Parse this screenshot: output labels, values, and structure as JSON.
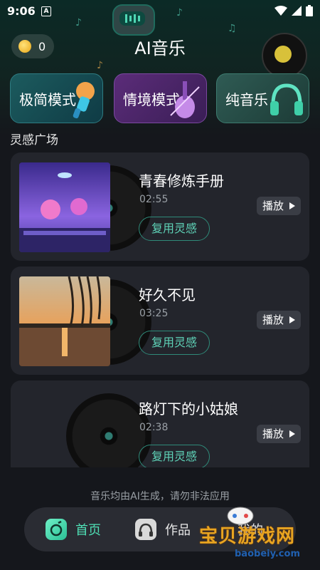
{
  "status": {
    "time": "9:06",
    "a_icon": "A",
    "icons": [
      "wifi-icon",
      "signal-icon",
      "battery-icon"
    ]
  },
  "header": {
    "coins": "0",
    "title": "AI音乐"
  },
  "modes": [
    {
      "label": "极简模式",
      "icon": "microphone-icon"
    },
    {
      "label": "情境模式",
      "icon": "violin-icon"
    },
    {
      "label": "纯音乐",
      "icon": "headphones-icon"
    }
  ],
  "section": {
    "title": "灵感广场"
  },
  "cards": [
    {
      "song": "青春修炼手册",
      "duration": "02:55",
      "reuse_label": "复用灵感",
      "play_label": "播放"
    },
    {
      "song": "好久不见",
      "duration": "03:25",
      "reuse_label": "复用灵感",
      "play_label": "播放"
    },
    {
      "song": "路灯下的小姑娘",
      "duration": "02:38",
      "reuse_label": "复用灵感",
      "play_label": "播放"
    }
  ],
  "footer": {
    "disclaimer": "音乐均由AI生成，请勿非法应用"
  },
  "nav": {
    "home": "首页",
    "works": "作品",
    "mine": "我的"
  },
  "watermark": {
    "text": "宝贝游戏网",
    "sub": "baobeiy.com"
  },
  "colors": {
    "accent": "#4fe0b5",
    "background": "#15171c",
    "card": "#23252c"
  }
}
